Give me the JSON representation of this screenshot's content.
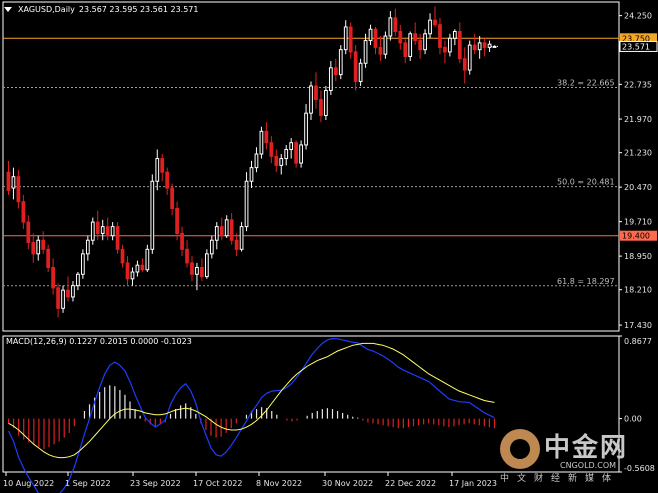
{
  "header": {
    "symbol_timeframe": "XAGUSD,Daily",
    "ohlc": "23.567 23.595 23.561 23.571"
  },
  "price_axis": {
    "ticks": [
      "24.250",
      "23.750",
      "23.571",
      "22.735",
      "21.970",
      "21.230",
      "20.470",
      "19.710",
      "19.400",
      "18.950",
      "18.210",
      "17.430"
    ],
    "min": 17.3,
    "max": 24.55
  },
  "levels": {
    "resistance": {
      "label": "23.750",
      "value": 23.75,
      "color": "#f5a623"
    },
    "support": {
      "label": "19.400",
      "value": 19.4,
      "color": "#ff6a4d"
    },
    "current": {
      "label": "23.571",
      "value": 23.571
    },
    "fib": [
      {
        "label": "38.2 = 22.665",
        "value": 22.665
      },
      {
        "label": "50.0 = 20.481",
        "value": 20.481
      },
      {
        "label": "61.8 = 18.297",
        "value": 18.297
      }
    ]
  },
  "macd": {
    "label": "MACD(12,26,9) 0.1227 0.2015 0.0000 -0.1023",
    "ticks": [
      "0.8677",
      "0.00",
      "-0.5608"
    ],
    "min": -0.5608,
    "max": 0.8677
  },
  "x_axis": {
    "labels": [
      "10 Aug 2022",
      "1 Sep 2022",
      "23 Sep 2022",
      "17 Oct 2022",
      "8 Nov 2022",
      "30 Nov 2022",
      "22 Dec 2022",
      "17 Jan 2023"
    ]
  },
  "colors": {
    "bull": "#ffffff",
    "bear": "#e02020",
    "macd_main": "#1f3cff",
    "macd_signal": "#ffff66",
    "grid_dash": "#9a9a9a",
    "axis": "#ffffff"
  },
  "watermark": {
    "cn": "中金网",
    "url": "CNGOLD.COM",
    "tagline": "中文财经新媒体"
  },
  "chart_data": {
    "type": "candlestick",
    "title": "XAGUSD,Daily",
    "ohlc_series": [
      [
        20.8,
        21.05,
        20.3,
        20.4
      ],
      [
        20.45,
        20.9,
        20.2,
        20.7
      ],
      [
        20.7,
        20.85,
        20.0,
        20.15
      ],
      [
        20.15,
        20.3,
        19.55,
        19.7
      ],
      [
        19.7,
        19.85,
        19.1,
        19.25
      ],
      [
        19.25,
        19.45,
        18.8,
        19.0
      ],
      [
        19.0,
        19.4,
        18.85,
        19.3
      ],
      [
        19.3,
        19.5,
        19.0,
        19.1
      ],
      [
        19.1,
        19.2,
        18.6,
        18.7
      ],
      [
        18.7,
        18.9,
        18.1,
        18.25
      ],
      [
        18.25,
        18.35,
        17.6,
        17.8
      ],
      [
        17.8,
        18.3,
        17.7,
        18.2
      ],
      [
        18.2,
        18.5,
        17.95,
        18.05
      ],
      [
        18.05,
        18.4,
        17.95,
        18.3
      ],
      [
        18.3,
        18.6,
        18.2,
        18.55
      ],
      [
        18.55,
        19.1,
        18.45,
        19.0
      ],
      [
        19.0,
        19.4,
        18.85,
        19.3
      ],
      [
        19.3,
        19.8,
        19.2,
        19.7
      ],
      [
        19.7,
        19.95,
        19.3,
        19.45
      ],
      [
        19.45,
        19.75,
        19.3,
        19.6
      ],
      [
        19.6,
        19.8,
        19.3,
        19.4
      ],
      [
        19.4,
        19.7,
        19.3,
        19.6
      ],
      [
        19.6,
        19.7,
        19.0,
        19.1
      ],
      [
        19.1,
        19.2,
        18.7,
        18.8
      ],
      [
        18.8,
        18.95,
        18.3,
        18.45
      ],
      [
        18.45,
        18.7,
        18.3,
        18.6
      ],
      [
        18.6,
        18.85,
        18.5,
        18.75
      ],
      [
        18.75,
        18.9,
        18.6,
        18.65
      ],
      [
        18.65,
        19.2,
        18.6,
        19.1
      ],
      [
        19.1,
        20.75,
        19.0,
        20.6
      ],
      [
        20.6,
        21.3,
        20.4,
        21.1
      ],
      [
        21.1,
        21.2,
        20.6,
        20.8
      ],
      [
        20.8,
        20.9,
        20.3,
        20.45
      ],
      [
        20.45,
        20.55,
        19.85,
        20.0
      ],
      [
        20.0,
        20.15,
        19.3,
        19.45
      ],
      [
        19.45,
        19.6,
        18.95,
        19.1
      ],
      [
        19.1,
        19.3,
        18.7,
        18.8
      ],
      [
        18.8,
        18.95,
        18.4,
        18.55
      ],
      [
        18.55,
        18.8,
        18.2,
        18.7
      ],
      [
        18.7,
        18.9,
        18.4,
        18.5
      ],
      [
        18.5,
        19.1,
        18.45,
        19.0
      ],
      [
        19.0,
        19.4,
        18.9,
        19.3
      ],
      [
        19.3,
        19.7,
        19.1,
        19.6
      ],
      [
        19.6,
        19.8,
        19.3,
        19.4
      ],
      [
        19.4,
        19.85,
        19.35,
        19.75
      ],
      [
        19.75,
        19.9,
        19.2,
        19.3
      ],
      [
        19.3,
        19.45,
        18.95,
        19.1
      ],
      [
        19.1,
        19.7,
        19.05,
        19.6
      ],
      [
        19.6,
        20.8,
        19.5,
        20.6
      ],
      [
        20.6,
        21.05,
        20.45,
        20.9
      ],
      [
        20.9,
        21.35,
        20.8,
        21.2
      ],
      [
        21.2,
        21.8,
        21.1,
        21.7
      ],
      [
        21.7,
        21.9,
        21.3,
        21.45
      ],
      [
        21.45,
        21.6,
        21.0,
        21.15
      ],
      [
        21.15,
        21.3,
        20.8,
        20.95
      ],
      [
        20.95,
        21.2,
        20.75,
        21.1
      ],
      [
        21.1,
        21.4,
        20.95,
        21.3
      ],
      [
        21.3,
        21.55,
        21.1,
        21.45
      ],
      [
        21.45,
        21.5,
        20.9,
        21.0
      ],
      [
        21.0,
        21.5,
        20.9,
        21.4
      ],
      [
        21.4,
        22.3,
        21.3,
        22.1
      ],
      [
        22.1,
        22.8,
        21.95,
        22.7
      ],
      [
        22.7,
        23.0,
        22.2,
        22.4
      ],
      [
        22.4,
        22.6,
        21.9,
        22.05
      ],
      [
        22.05,
        22.7,
        21.95,
        22.6
      ],
      [
        22.6,
        23.25,
        22.5,
        23.1
      ],
      [
        23.1,
        23.3,
        22.8,
        22.95
      ],
      [
        22.95,
        23.6,
        22.85,
        23.5
      ],
      [
        23.5,
        24.15,
        23.4,
        24.0
      ],
      [
        24.0,
        24.1,
        23.3,
        23.45
      ],
      [
        23.45,
        23.6,
        22.6,
        22.8
      ],
      [
        22.8,
        23.3,
        22.7,
        23.2
      ],
      [
        23.2,
        23.85,
        23.1,
        23.7
      ],
      [
        23.7,
        24.05,
        23.6,
        23.95
      ],
      [
        23.95,
        24.0,
        23.4,
        23.55
      ],
      [
        23.55,
        23.8,
        23.25,
        23.4
      ],
      [
        23.4,
        23.9,
        23.3,
        23.8
      ],
      [
        23.8,
        24.35,
        23.7,
        24.2
      ],
      [
        24.2,
        24.4,
        23.8,
        23.9
      ],
      [
        23.9,
        24.05,
        23.5,
        23.65
      ],
      [
        23.65,
        23.75,
        23.2,
        23.35
      ],
      [
        23.35,
        23.9,
        23.25,
        23.85
      ],
      [
        23.85,
        24.1,
        23.6,
        23.7
      ],
      [
        23.7,
        23.85,
        23.3,
        23.5
      ],
      [
        23.5,
        23.95,
        23.4,
        23.85
      ],
      [
        23.85,
        24.3,
        23.75,
        24.15
      ],
      [
        24.15,
        24.45,
        24.0,
        24.05
      ],
      [
        24.05,
        24.2,
        23.4,
        23.55
      ],
      [
        23.55,
        23.7,
        23.2,
        23.45
      ],
      [
        23.45,
        23.85,
        23.35,
        23.75
      ],
      [
        23.75,
        23.95,
        23.6,
        23.9
      ],
      [
        23.9,
        24.1,
        23.2,
        23.3
      ],
      [
        23.3,
        23.55,
        22.75,
        23.05
      ],
      [
        23.05,
        23.7,
        22.95,
        23.6
      ],
      [
        23.6,
        23.85,
        23.4,
        23.5
      ],
      [
        23.5,
        23.8,
        23.3,
        23.65
      ],
      [
        23.65,
        23.75,
        23.35,
        23.55
      ],
      [
        23.55,
        23.7,
        23.45,
        23.62
      ],
      [
        23.567,
        23.595,
        23.561,
        23.571
      ]
    ],
    "macd_histogram": [
      -0.05,
      -0.1,
      -0.18,
      -0.22,
      -0.25,
      -0.27,
      -0.3,
      -0.32,
      -0.3,
      -0.27,
      -0.24,
      -0.2,
      -0.15,
      -0.08,
      0.0,
      0.08,
      0.15,
      0.22,
      0.28,
      0.33,
      0.35,
      0.34,
      0.3,
      0.25,
      0.18,
      0.1,
      0.03,
      -0.03,
      -0.06,
      -0.08,
      -0.06,
      -0.04,
      0.05,
      0.1,
      0.14,
      0.16,
      0.12,
      0.05,
      -0.05,
      -0.12,
      -0.18,
      -0.2,
      -0.19,
      -0.15,
      -0.1,
      -0.05,
      0.0,
      0.04,
      0.08,
      0.1,
      0.12,
      0.11,
      0.08,
      0.04,
      0.0,
      -0.02,
      -0.03,
      -0.02,
      0.0,
      0.03,
      0.06,
      0.08,
      0.1,
      0.11,
      0.1,
      0.08,
      0.06,
      0.04,
      0.02,
      0.01,
      -0.02,
      -0.04,
      -0.05,
      -0.06,
      -0.07,
      -0.08,
      -0.09,
      -0.1,
      -0.1,
      -0.09,
      -0.08,
      -0.07,
      -0.06,
      -0.05,
      -0.06,
      -0.07,
      -0.08,
      -0.09,
      -0.08,
      -0.07,
      -0.06,
      -0.05,
      -0.06,
      -0.07,
      -0.08,
      -0.09,
      -0.1
    ],
    "macd_signal": [
      -0.05,
      -0.08,
      -0.12,
      -0.17,
      -0.22,
      -0.27,
      -0.31,
      -0.35,
      -0.38,
      -0.4,
      -0.41,
      -0.41,
      -0.4,
      -0.38,
      -0.34,
      -0.29,
      -0.24,
      -0.18,
      -0.12,
      -0.06,
      0.0,
      0.05,
      0.08,
      0.1,
      0.1,
      0.09,
      0.08,
      0.06,
      0.05,
      0.04,
      0.04,
      0.05,
      0.07,
      0.09,
      0.1,
      0.11,
      0.1,
      0.08,
      0.05,
      0.02,
      -0.02,
      -0.06,
      -0.09,
      -0.11,
      -0.12,
      -0.12,
      -0.11,
      -0.09,
      -0.06,
      -0.02,
      0.03,
      0.09,
      0.16,
      0.23,
      0.3,
      0.36,
      0.42,
      0.47,
      0.51,
      0.55,
      0.58,
      0.61,
      0.63,
      0.65,
      0.68,
      0.71,
      0.73,
      0.75,
      0.77,
      0.78,
      0.79,
      0.79,
      0.79,
      0.78,
      0.77,
      0.75,
      0.73,
      0.7,
      0.67,
      0.63,
      0.59,
      0.55,
      0.51,
      0.47,
      0.44,
      0.41,
      0.38,
      0.35,
      0.32,
      0.29,
      0.27,
      0.25,
      0.23,
      0.21,
      0.19,
      0.18,
      0.17
    ]
  }
}
